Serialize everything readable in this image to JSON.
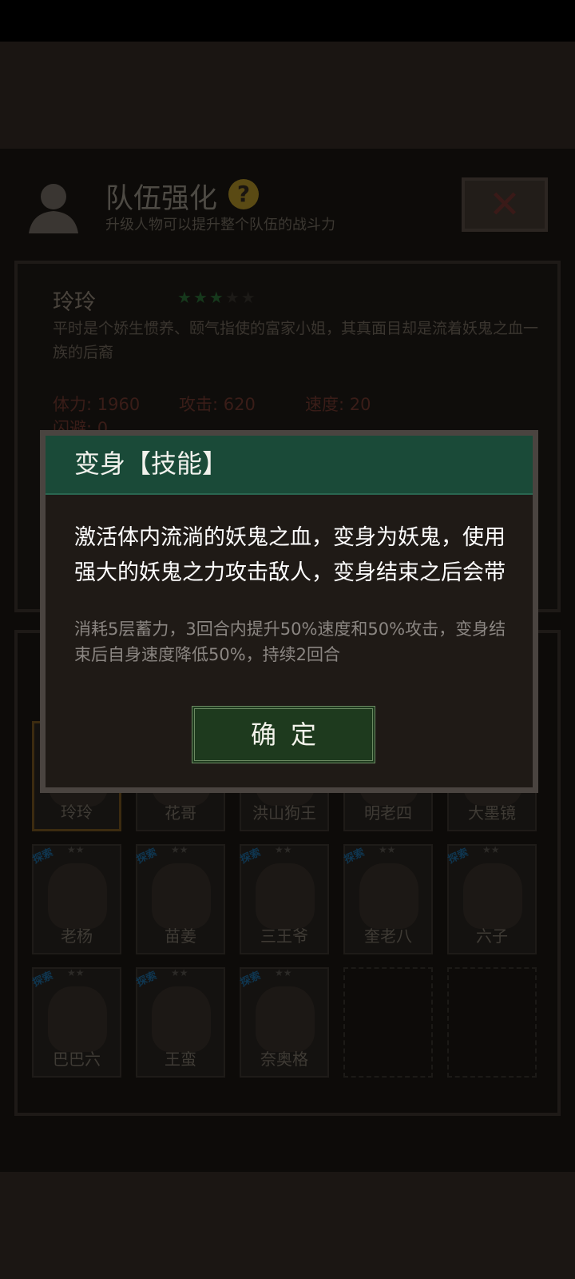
{
  "header": {
    "title": "队伍强化",
    "subtitle": "升级人物可以提升整个队伍的战斗力",
    "help_symbol": "?",
    "close_symbol": "✕"
  },
  "character": {
    "name": "玲玲",
    "stars_filled": 3,
    "stars_total": 5,
    "description": "平时是个娇生惯养、颐气指使的富家小姐，其真面目却是流着妖鬼之血一族的后裔",
    "stats": {
      "hp": "体力: 1960",
      "atk": "攻击: 620",
      "spd": "速度: 20",
      "eva": "闪避: 0"
    }
  },
  "roster": {
    "explore_tag": "探索",
    "row1": [
      "玲玲",
      "花哥",
      "洪山狗王",
      "明老四",
      "大墨镜"
    ],
    "row2": [
      "老杨",
      "苗姜",
      "三王爷",
      "奎老八",
      "六子"
    ],
    "row3": [
      "巴巴六",
      "王蛮",
      "奈奥格"
    ]
  },
  "dialog": {
    "title": "变身【技能】",
    "main_text": "激活体内流淌的妖鬼之血，变身为妖鬼，使用强大的妖鬼之力攻击敌人，变身结束之后会带",
    "detail_text": "消耗5层蓄力，3回合内提升50%速度和50%攻击，变身结束后自身速度降低50%，持续2回合",
    "confirm_label": "确定"
  },
  "colors": {
    "dialog_header": "#1a4a38",
    "dialog_bg": "#1f1a16",
    "confirm_bg": "#1e3a1e"
  }
}
